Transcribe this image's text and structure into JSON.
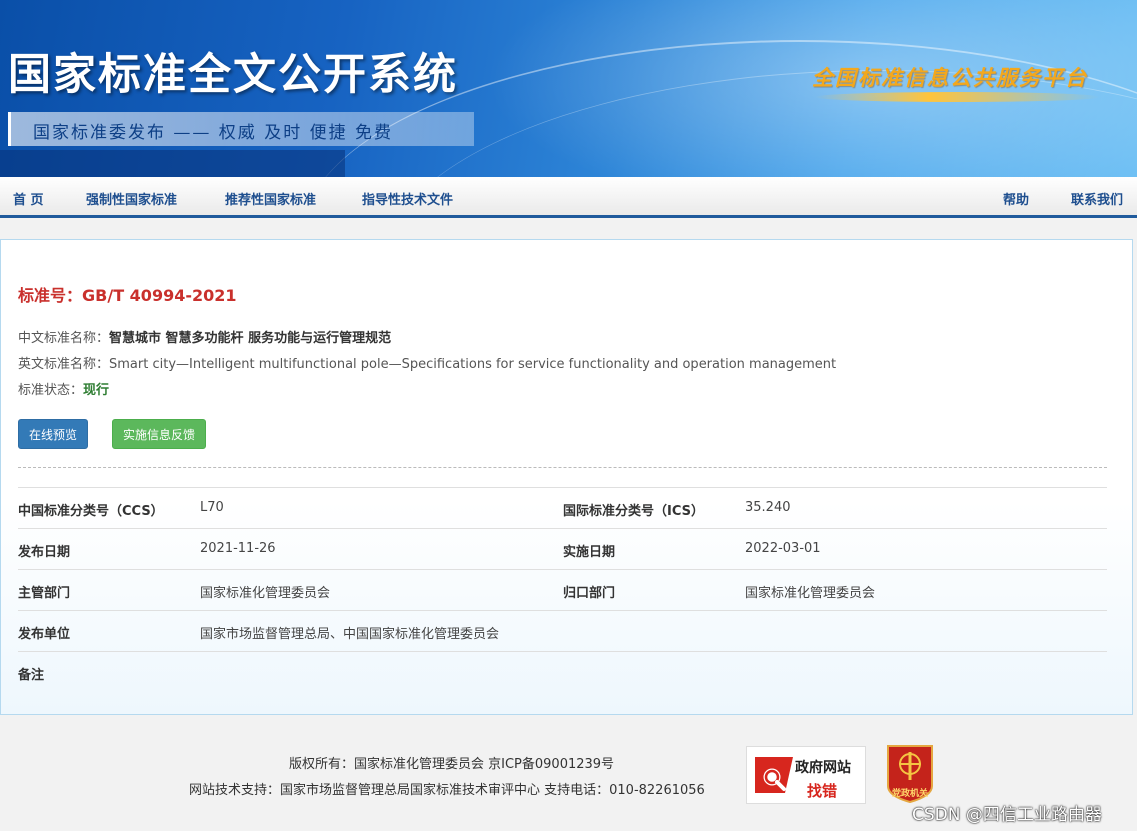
{
  "header": {
    "site_title": "国家标准全文公开系统",
    "slogan": "国家标准委发布 —— 权威 及时 便捷 免费",
    "platform_name": "全国标准信息公共服务平台"
  },
  "nav": {
    "items": [
      "首 页",
      "强制性国家标准",
      "推荐性国家标准",
      "指导性技术文件"
    ],
    "help": "帮助",
    "contact": "联系我们"
  },
  "standard": {
    "number_label": "标准号：",
    "number": "GB/T 40994-2021",
    "cn_name_label": "中文标准名称：",
    "cn_name": "智慧城市 智慧多功能杆 服务功能与运行管理规范",
    "en_name_label": "英文标准名称：",
    "en_name": "Smart city—Intelligent multifunctional pole—Specifications for service functionality and operation management",
    "status_label": "标准状态：",
    "status": "现行"
  },
  "buttons": {
    "preview": "在线预览",
    "feedback": "实施信息反馈"
  },
  "details": {
    "ccs_label": "中国标准分类号（CCS）",
    "ccs": "L70",
    "ics_label": "国际标准分类号（ICS）",
    "ics": "35.240",
    "publish_date_label": "发布日期",
    "publish_date": "2021-11-26",
    "implement_date_label": "实施日期",
    "implement_date": "2022-03-01",
    "competent_dept_label": "主管部门",
    "competent_dept": "国家标准化管理委员会",
    "centralized_dept_label": "归口部门",
    "centralized_dept": "国家标准化管理委员会",
    "issuer_label": "发布单位",
    "issuer": "国家市场监督管理总局、中国国家标准化管理委员会",
    "remark_label": "备注",
    "remark": ""
  },
  "footer": {
    "copyright": "版权所有：国家标准化管理委员会 京ICP备09001239号",
    "support": "网站技术支持：国家市场监督管理总局国家标准技术审评中心 支持电话：010-82261056",
    "gov_badge_line1": "政府网站",
    "gov_badge_line2": "找错",
    "party_badge": "党政机关"
  },
  "watermark": "CSDN @四信工业路由器",
  "colors": {
    "nav_text": "#1f4f8f",
    "std_number": "#c9302c",
    "status": "#2e7d32",
    "preview_button": "#337ab7",
    "feedback_button": "#5cb85c"
  },
  "icons": [
    "gov-site-error-icon",
    "party-organ-emblem-icon"
  ]
}
